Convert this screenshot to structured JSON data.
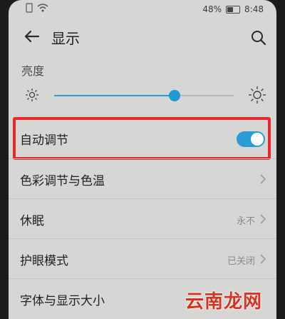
{
  "status": {
    "battery": "48%",
    "time": "8:48"
  },
  "appbar": {
    "title": "显示"
  },
  "brightness": {
    "label": "亮度",
    "level": 0.67
  },
  "rows": [
    {
      "label": "自动调节",
      "value": "",
      "toggle_on": true
    },
    {
      "label": "色彩调节与色温",
      "value": ""
    },
    {
      "label": "休眠",
      "value": "永不"
    },
    {
      "label": "护眼模式",
      "value": "已关闭"
    },
    {
      "label": "字体与显示大小",
      "value": ""
    }
  ],
  "watermark": "云南龙网",
  "colors": {
    "accent": "#2a9ed4",
    "highlight": "#e8282a",
    "watermark": "#d83320"
  }
}
